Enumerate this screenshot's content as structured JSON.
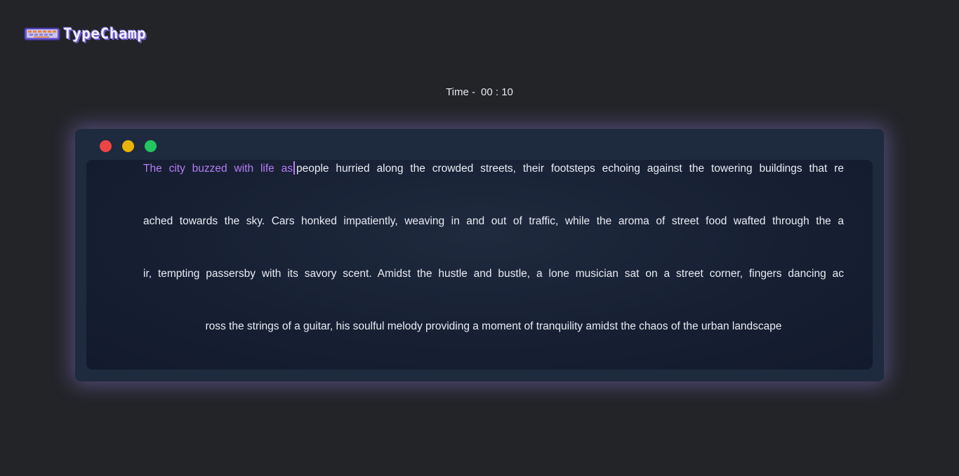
{
  "app": {
    "name": "TypeChamp",
    "logo_icon": "keyboard-icon"
  },
  "timer": {
    "label": "Time -",
    "value": "00 : 10"
  },
  "window_controls": {
    "colors": {
      "close": "#ef4444",
      "minimize": "#eab308",
      "maximize": "#22c55e"
    }
  },
  "typing": {
    "typed_text": "The city buzzed with life as",
    "typed_color": "#b57cf5",
    "line1_rest": "people hurried along the crowded streets, their footsteps echoing against the towering buildings that re",
    "line2": "ached towards the sky. Cars honked impatiently, weaving in and out of traffic, while the aroma of street food wafted through the a",
    "line3": "ir, tempting passersby with its savory scent. Amidst the hustle and bustle, a lone musician sat on a street corner, fingers dancing ac",
    "line4": "ross the strings of a guitar, his soulful melody providing a moment of tranquility amidst the chaos of the urban landscape"
  }
}
